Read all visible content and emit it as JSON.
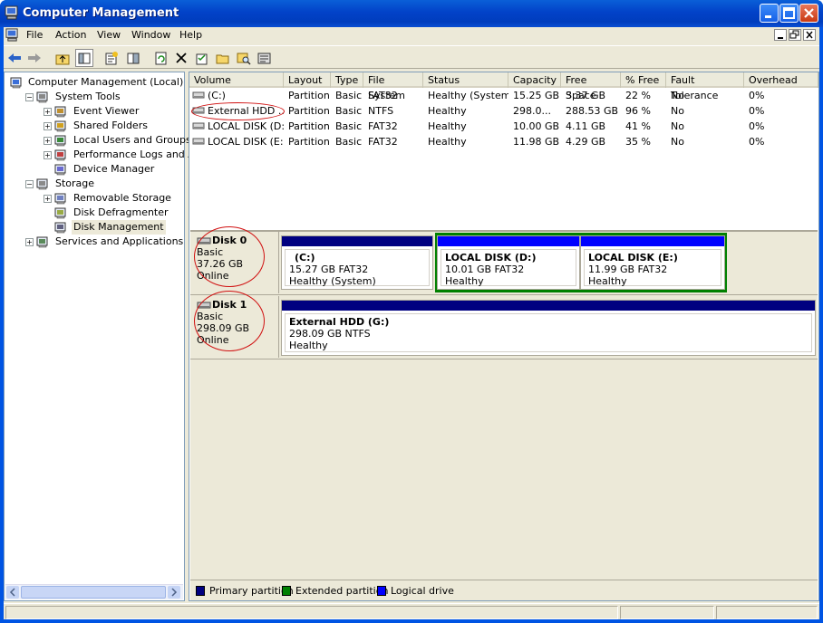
{
  "window": {
    "title": "Computer Management"
  },
  "menu": {
    "items": [
      "File",
      "Action",
      "View",
      "Window",
      "Help"
    ]
  },
  "tree": {
    "items": [
      {
        "label": "Computer Management (Local)",
        "icon": "computer-icon",
        "depth": 0,
        "expander": "none"
      },
      {
        "label": "System Tools",
        "icon": "tools-icon",
        "depth": 1,
        "expander": "minus"
      },
      {
        "label": "Event Viewer",
        "icon": "event-viewer-icon",
        "depth": 2,
        "expander": "plus"
      },
      {
        "label": "Shared Folders",
        "icon": "shared-folder-icon",
        "depth": 2,
        "expander": "plus"
      },
      {
        "label": "Local Users and Groups",
        "icon": "users-icon",
        "depth": 2,
        "expander": "plus"
      },
      {
        "label": "Performance Logs and Alerts",
        "icon": "performance-icon",
        "depth": 2,
        "expander": "plus"
      },
      {
        "label": "Device Manager",
        "icon": "device-manager-icon",
        "depth": 2,
        "expander": "none"
      },
      {
        "label": "Storage",
        "icon": "storage-icon",
        "depth": 1,
        "expander": "minus"
      },
      {
        "label": "Removable Storage",
        "icon": "removable-storage-icon",
        "depth": 2,
        "expander": "plus"
      },
      {
        "label": "Disk Defragmenter",
        "icon": "defrag-icon",
        "depth": 2,
        "expander": "none"
      },
      {
        "label": "Disk Management",
        "icon": "disk-management-icon",
        "depth": 2,
        "expander": "none",
        "selected": true
      },
      {
        "label": "Services and Applications",
        "icon": "services-icon",
        "depth": 1,
        "expander": "plus"
      }
    ]
  },
  "volumes": {
    "columns": [
      "Volume",
      "Layout",
      "Type",
      "File System",
      "Status",
      "Capacity",
      "Free Space",
      "% Free",
      "Fault Tolerance",
      "Overhead"
    ],
    "rows": [
      [
        "(C:)",
        "Partition",
        "Basic",
        "FAT32",
        "Healthy (System)",
        "15.25 GB",
        "3.37 GB",
        "22 %",
        "No",
        "0%"
      ],
      [
        "External HDD ...",
        "Partition",
        "Basic",
        "NTFS",
        "Healthy",
        "298.0...",
        "288.53 GB",
        "96 %",
        "No",
        "0%"
      ],
      [
        "LOCAL DISK (D:)",
        "Partition",
        "Basic",
        "FAT32",
        "Healthy",
        "10.00 GB",
        "4.11 GB",
        "41 %",
        "No",
        "0%"
      ],
      [
        "LOCAL DISK (E:)",
        "Partition",
        "Basic",
        "FAT32",
        "Healthy",
        "11.98 GB",
        "4.29 GB",
        "35 %",
        "No",
        "0%"
      ]
    ]
  },
  "disks": [
    {
      "name": "Disk 0",
      "type": "Basic",
      "size": "37.26 GB",
      "state": "Online",
      "partitions": [
        {
          "title": "(C:)",
          "detail": "15.27 GB FAT32",
          "status": "Healthy (System)",
          "kind": "primary"
        },
        {
          "title": "LOCAL DISK  (D:)",
          "detail": "10.01 GB FAT32",
          "status": "Healthy",
          "kind": "logical"
        },
        {
          "title": "LOCAL DISK  (E:)",
          "detail": "11.99 GB FAT32",
          "status": "Healthy",
          "kind": "logical"
        }
      ]
    },
    {
      "name": "Disk 1",
      "type": "Basic",
      "size": "298.09 GB",
      "state": "Online",
      "partitions": [
        {
          "title": "External HDD  (G:)",
          "detail": "298.09 GB NTFS",
          "status": "Healthy",
          "kind": "primary"
        }
      ]
    }
  ],
  "legend": [
    {
      "label": "Primary partition",
      "color": "#000080"
    },
    {
      "label": "Extended partition",
      "color": "#008000"
    },
    {
      "label": "Logical drive",
      "color": "#0000ff"
    }
  ],
  "colors": {
    "primary": "#000080",
    "extended": "#008000",
    "logical": "#0000ff",
    "annotation": "#d01010"
  }
}
